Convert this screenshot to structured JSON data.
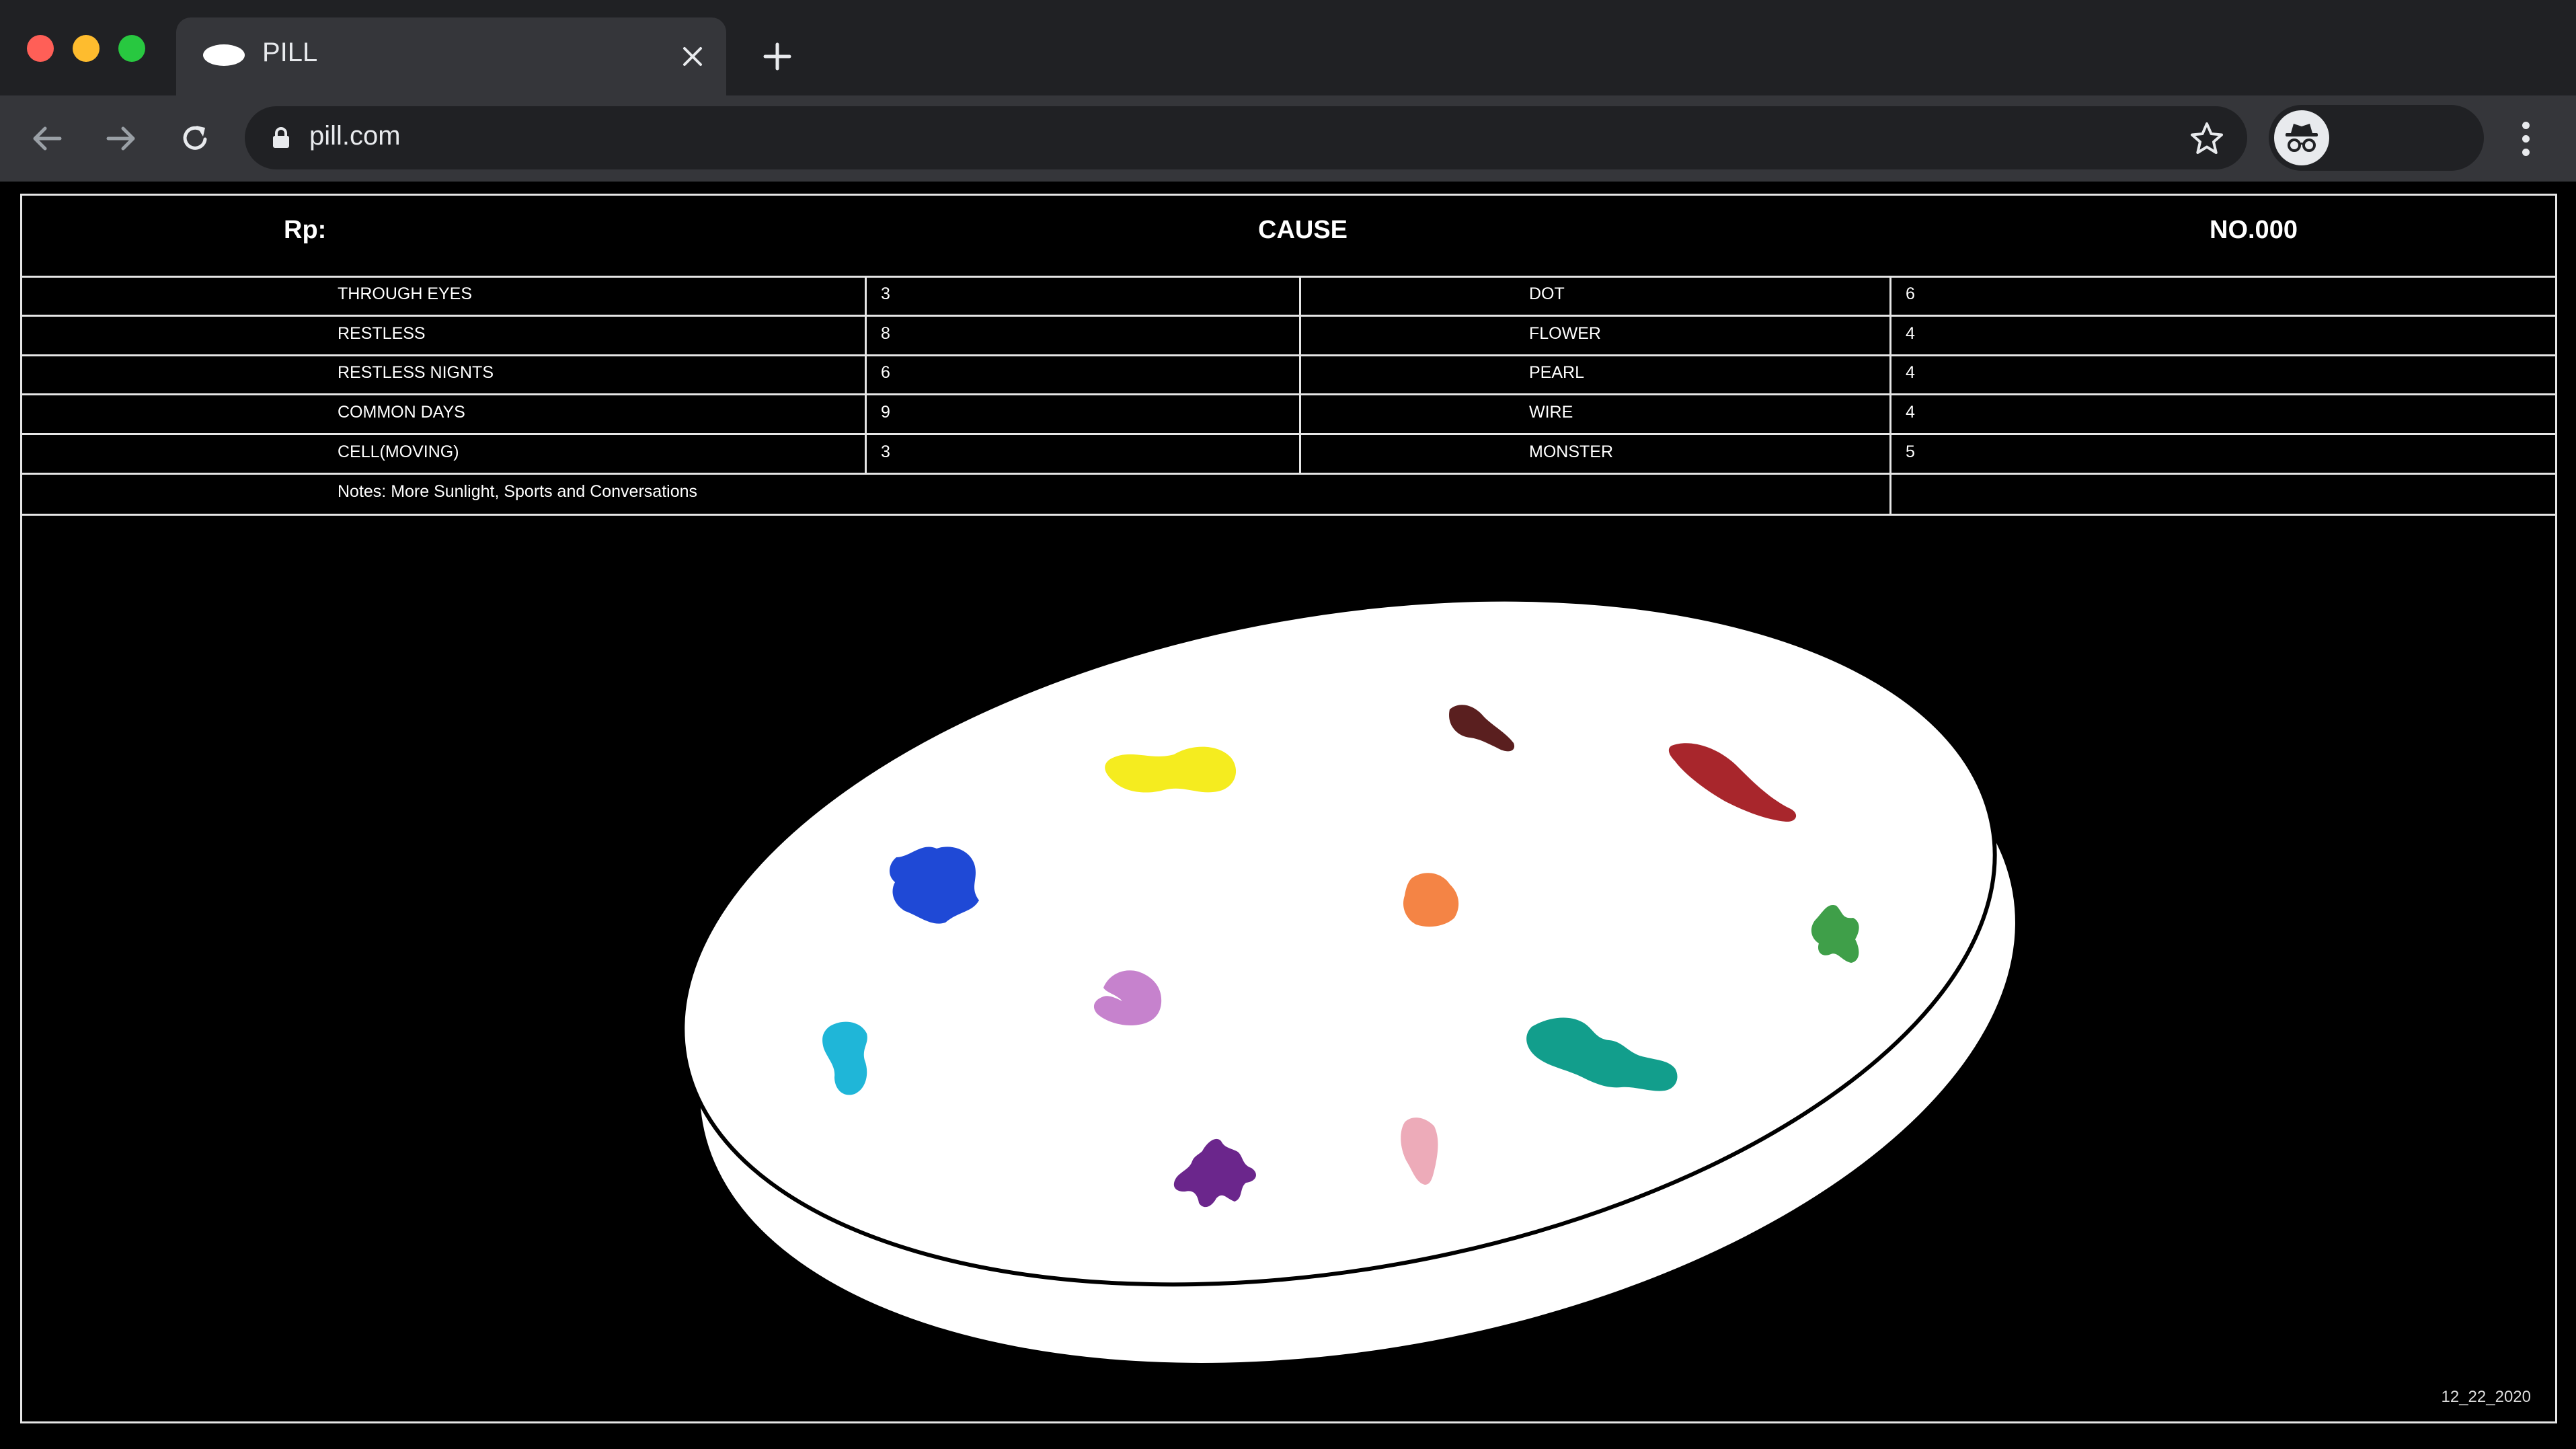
{
  "browser": {
    "tab_title": "PILL",
    "url": "pill.com"
  },
  "prescription": {
    "rp_label": "Rp:",
    "cause_label": "CAUSE",
    "number_label": "NO.000",
    "rows": [
      {
        "cause": "THROUGH EYES",
        "value": "3",
        "shape": "DOT",
        "count": "6"
      },
      {
        "cause": "RESTLESS",
        "value": "8",
        "shape": "FLOWER",
        "count": "4"
      },
      {
        "cause": "RESTLESS NIGNTS",
        "value": "6",
        "shape": "PEARL",
        "count": "4"
      },
      {
        "cause": "COMMON DAYS",
        "value": "9",
        "shape": "WIRE",
        "count": "4"
      },
      {
        "cause": "CELL(MOVING)",
        "value": "3",
        "shape": "MONSTER",
        "count": "5"
      }
    ],
    "notes": "Notes: More Sunlight, Sports and Conversations"
  },
  "pill": {
    "body_color": "#ffffff",
    "outline_color": "#000000",
    "blob_colors": [
      "#f5ec1f",
      "#5a1f1f",
      "#a8262c",
      "#1f49d6",
      "#f48445",
      "#3f9f49",
      "#c682cd",
      "#1fb6d8",
      "#129e8c",
      "#edabb9",
      "#6b268c"
    ]
  },
  "footer": {
    "date": "12_22_2020"
  }
}
